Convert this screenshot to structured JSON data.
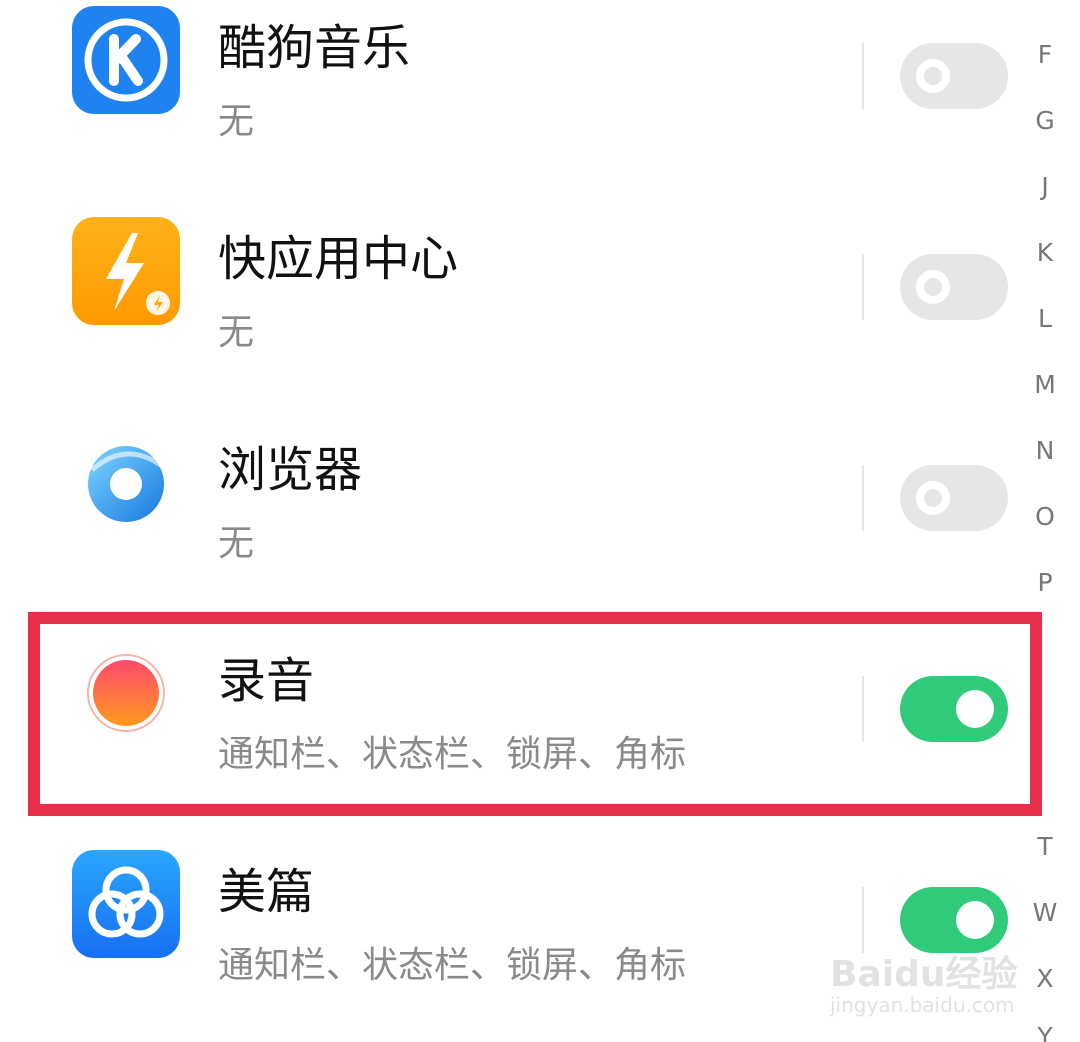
{
  "apps": [
    {
      "name": "酷狗音乐",
      "permissions": "无",
      "toggle": "off",
      "icon": "kugou-music-icon"
    },
    {
      "name": "快应用中心",
      "permissions": "无",
      "toggle": "off",
      "icon": "quick-app-center-icon"
    },
    {
      "name": "浏览器",
      "permissions": "无",
      "toggle": "off",
      "icon": "browser-icon"
    },
    {
      "name": "录音",
      "permissions": "通知栏、状态栏、锁屏、角标",
      "toggle": "on",
      "icon": "recorder-icon"
    },
    {
      "name": "美篇",
      "permissions": "通知栏、状态栏、锁屏、角标",
      "toggle": "on",
      "icon": "meipian-icon"
    }
  ],
  "index_letters": [
    "F",
    "G",
    "J",
    "K",
    "L",
    "M",
    "N",
    "O",
    "P",
    "T",
    "W",
    "X",
    "Y"
  ],
  "watermark": {
    "brand": "Baidu经验",
    "url": "jingyan.baidu.com"
  },
  "colors": {
    "toggle_on": "#2fca7a",
    "toggle_off": "#e6e6e6",
    "highlight": "#e8304a"
  }
}
